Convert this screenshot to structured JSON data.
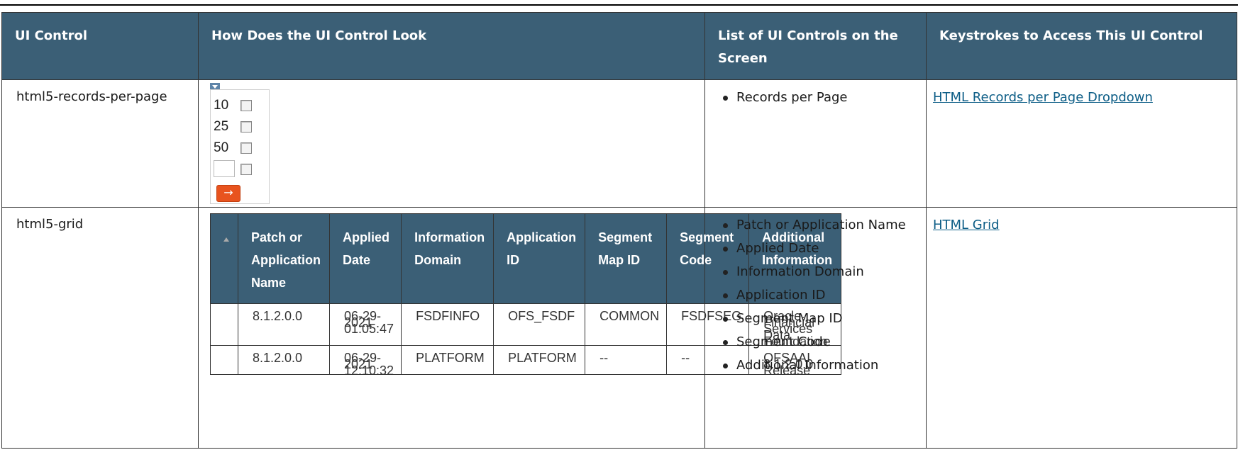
{
  "table": {
    "headers": [
      "UI Control",
      "How Does the UI Control Look",
      "List of UI Controls on the Screen",
      "Keystrokes to Access This UI Control"
    ],
    "rows": [
      {
        "control": "html5-records-per-page",
        "preview": {
          "options": [
            "10",
            "25",
            "50",
            ""
          ],
          "go_icon": "arrow-right-icon"
        },
        "controls": [
          "Records per Page"
        ],
        "keystroke_link": "HTML Records per Page Dropdown"
      },
      {
        "control": "html5-grid",
        "preview": {
          "columns": [
            "Patch or Application Name",
            "Applied Date",
            "Information Domain",
            "Application ID",
            "Segment Map ID",
            "Segment Code",
            "Additional Information"
          ],
          "rows": [
            [
              "8.1.2.0.0",
              "06-29-2021 01:05:47",
              "FSDFINFO",
              "OFS_FSDF",
              "COMMON",
              "FSDFSEG",
              "Oracle Financial Services Data Foundation"
            ],
            [
              "8.1.2.0.0",
              "06-29-2021 12:10:32",
              "PLATFORM",
              "PLATFORM",
              "--",
              "--",
              "OFSAAI 8.1.2.0.0 Release"
            ]
          ]
        },
        "controls": [
          "Patch or Application Name",
          "Applied Date",
          "Information Domain",
          "Application ID",
          "Segment Map ID",
          "Segment Code",
          "Additional Information"
        ],
        "keystroke_link": "HTML Grid"
      }
    ]
  }
}
